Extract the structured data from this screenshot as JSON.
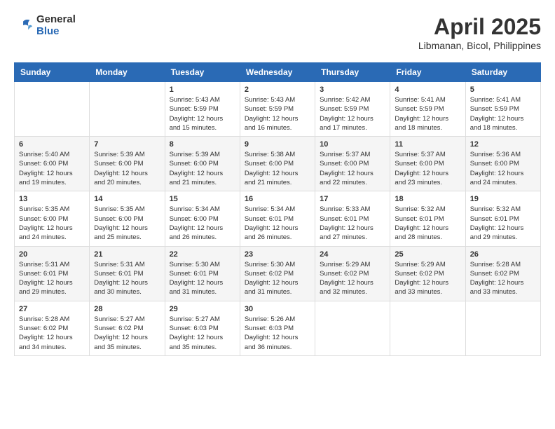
{
  "header": {
    "logo_general": "General",
    "logo_blue": "Blue",
    "month": "April 2025",
    "location": "Libmanan, Bicol, Philippines"
  },
  "days_of_week": [
    "Sunday",
    "Monday",
    "Tuesday",
    "Wednesday",
    "Thursday",
    "Friday",
    "Saturday"
  ],
  "weeks": [
    [
      {
        "day": "",
        "info": ""
      },
      {
        "day": "",
        "info": ""
      },
      {
        "day": "1",
        "info": "Sunrise: 5:43 AM\nSunset: 5:59 PM\nDaylight: 12 hours and 15 minutes."
      },
      {
        "day": "2",
        "info": "Sunrise: 5:43 AM\nSunset: 5:59 PM\nDaylight: 12 hours and 16 minutes."
      },
      {
        "day": "3",
        "info": "Sunrise: 5:42 AM\nSunset: 5:59 PM\nDaylight: 12 hours and 17 minutes."
      },
      {
        "day": "4",
        "info": "Sunrise: 5:41 AM\nSunset: 5:59 PM\nDaylight: 12 hours and 18 minutes."
      },
      {
        "day": "5",
        "info": "Sunrise: 5:41 AM\nSunset: 5:59 PM\nDaylight: 12 hours and 18 minutes."
      }
    ],
    [
      {
        "day": "6",
        "info": "Sunrise: 5:40 AM\nSunset: 6:00 PM\nDaylight: 12 hours and 19 minutes."
      },
      {
        "day": "7",
        "info": "Sunrise: 5:39 AM\nSunset: 6:00 PM\nDaylight: 12 hours and 20 minutes."
      },
      {
        "day": "8",
        "info": "Sunrise: 5:39 AM\nSunset: 6:00 PM\nDaylight: 12 hours and 21 minutes."
      },
      {
        "day": "9",
        "info": "Sunrise: 5:38 AM\nSunset: 6:00 PM\nDaylight: 12 hours and 21 minutes."
      },
      {
        "day": "10",
        "info": "Sunrise: 5:37 AM\nSunset: 6:00 PM\nDaylight: 12 hours and 22 minutes."
      },
      {
        "day": "11",
        "info": "Sunrise: 5:37 AM\nSunset: 6:00 PM\nDaylight: 12 hours and 23 minutes."
      },
      {
        "day": "12",
        "info": "Sunrise: 5:36 AM\nSunset: 6:00 PM\nDaylight: 12 hours and 24 minutes."
      }
    ],
    [
      {
        "day": "13",
        "info": "Sunrise: 5:35 AM\nSunset: 6:00 PM\nDaylight: 12 hours and 24 minutes."
      },
      {
        "day": "14",
        "info": "Sunrise: 5:35 AM\nSunset: 6:00 PM\nDaylight: 12 hours and 25 minutes."
      },
      {
        "day": "15",
        "info": "Sunrise: 5:34 AM\nSunset: 6:00 PM\nDaylight: 12 hours and 26 minutes."
      },
      {
        "day": "16",
        "info": "Sunrise: 5:34 AM\nSunset: 6:01 PM\nDaylight: 12 hours and 26 minutes."
      },
      {
        "day": "17",
        "info": "Sunrise: 5:33 AM\nSunset: 6:01 PM\nDaylight: 12 hours and 27 minutes."
      },
      {
        "day": "18",
        "info": "Sunrise: 5:32 AM\nSunset: 6:01 PM\nDaylight: 12 hours and 28 minutes."
      },
      {
        "day": "19",
        "info": "Sunrise: 5:32 AM\nSunset: 6:01 PM\nDaylight: 12 hours and 29 minutes."
      }
    ],
    [
      {
        "day": "20",
        "info": "Sunrise: 5:31 AM\nSunset: 6:01 PM\nDaylight: 12 hours and 29 minutes."
      },
      {
        "day": "21",
        "info": "Sunrise: 5:31 AM\nSunset: 6:01 PM\nDaylight: 12 hours and 30 minutes."
      },
      {
        "day": "22",
        "info": "Sunrise: 5:30 AM\nSunset: 6:01 PM\nDaylight: 12 hours and 31 minutes."
      },
      {
        "day": "23",
        "info": "Sunrise: 5:30 AM\nSunset: 6:02 PM\nDaylight: 12 hours and 31 minutes."
      },
      {
        "day": "24",
        "info": "Sunrise: 5:29 AM\nSunset: 6:02 PM\nDaylight: 12 hours and 32 minutes."
      },
      {
        "day": "25",
        "info": "Sunrise: 5:29 AM\nSunset: 6:02 PM\nDaylight: 12 hours and 33 minutes."
      },
      {
        "day": "26",
        "info": "Sunrise: 5:28 AM\nSunset: 6:02 PM\nDaylight: 12 hours and 33 minutes."
      }
    ],
    [
      {
        "day": "27",
        "info": "Sunrise: 5:28 AM\nSunset: 6:02 PM\nDaylight: 12 hours and 34 minutes."
      },
      {
        "day": "28",
        "info": "Sunrise: 5:27 AM\nSunset: 6:02 PM\nDaylight: 12 hours and 35 minutes."
      },
      {
        "day": "29",
        "info": "Sunrise: 5:27 AM\nSunset: 6:03 PM\nDaylight: 12 hours and 35 minutes."
      },
      {
        "day": "30",
        "info": "Sunrise: 5:26 AM\nSunset: 6:03 PM\nDaylight: 12 hours and 36 minutes."
      },
      {
        "day": "",
        "info": ""
      },
      {
        "day": "",
        "info": ""
      },
      {
        "day": "",
        "info": ""
      }
    ]
  ]
}
